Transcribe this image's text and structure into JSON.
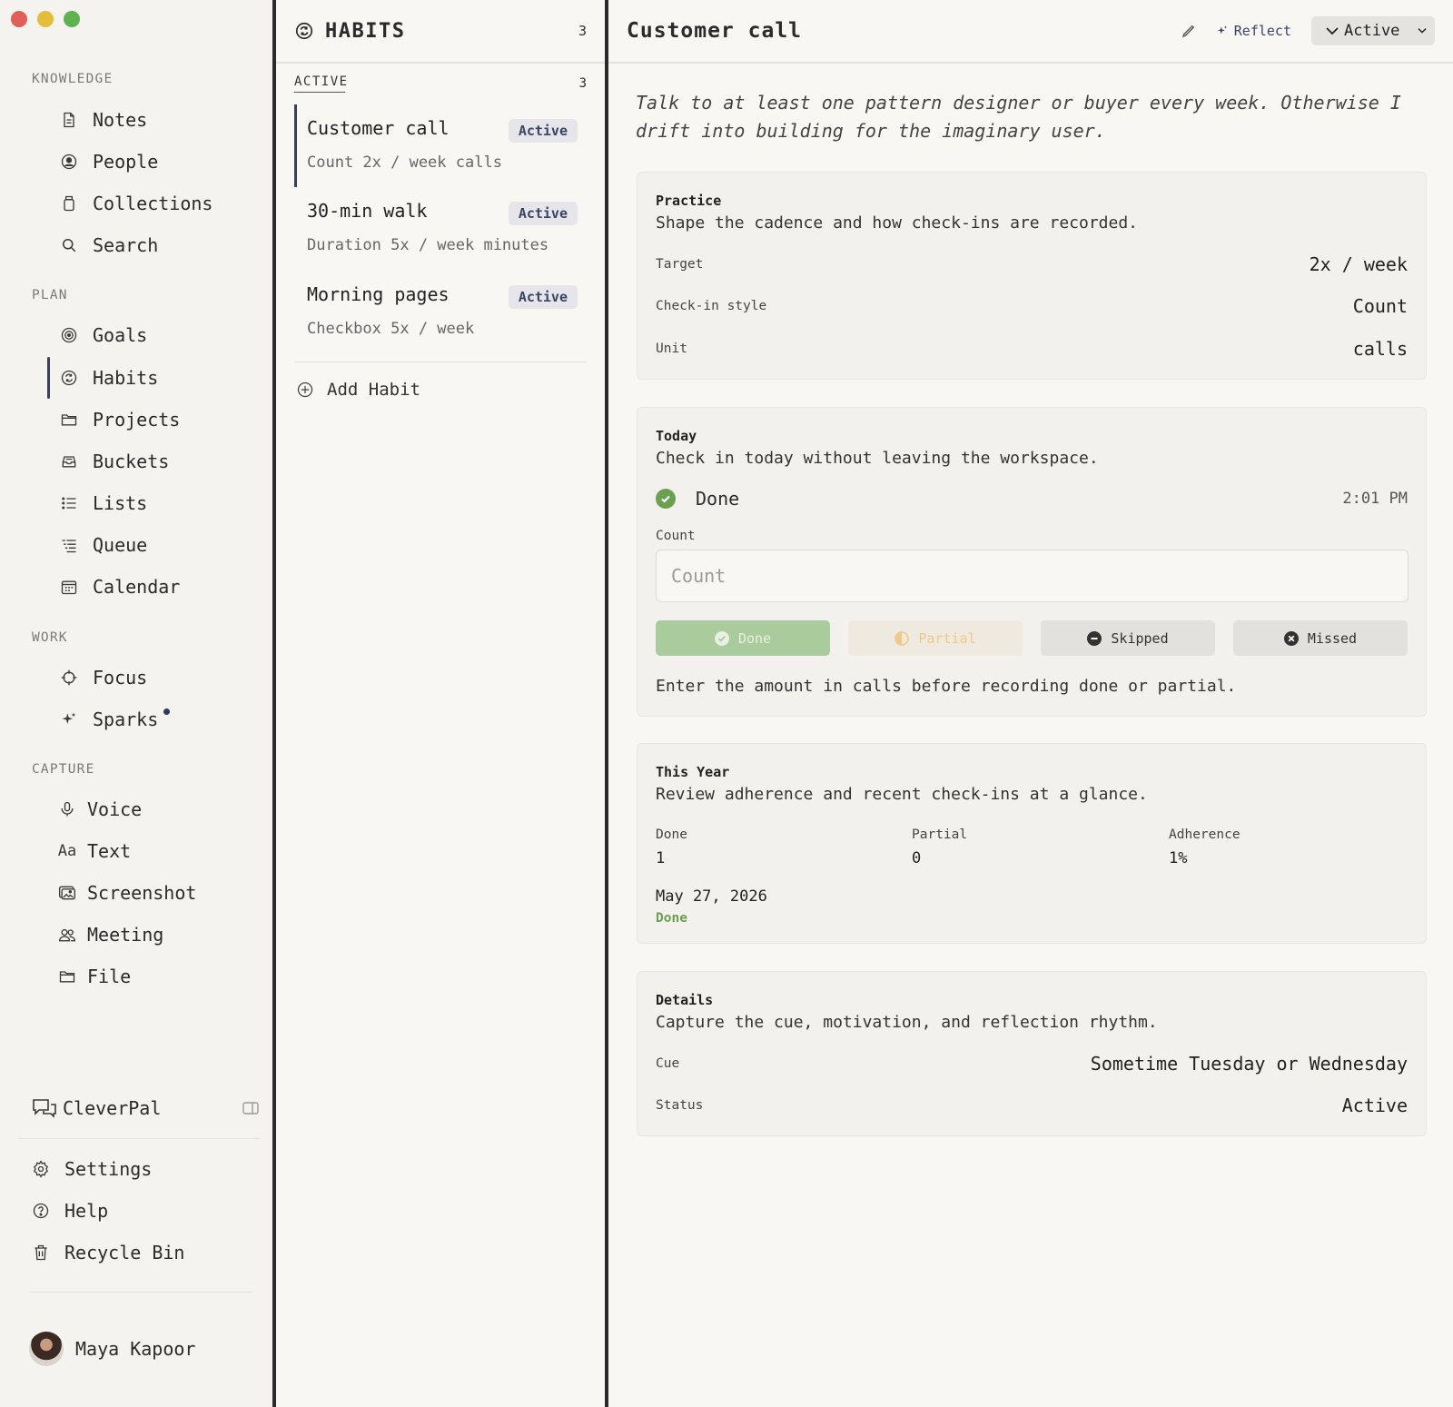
{
  "sidebar": {
    "sections": {
      "knowledge": "KNOWLEDGE",
      "plan": "PLAN",
      "work": "WORK",
      "capture": "CAPTURE"
    },
    "knowledge_items": [
      {
        "label": "Notes",
        "icon": "document-icon"
      },
      {
        "label": "People",
        "icon": "person-circle-icon"
      },
      {
        "label": "Collections",
        "icon": "jar-icon"
      },
      {
        "label": "Search",
        "icon": "search-icon"
      }
    ],
    "plan_items": [
      {
        "label": "Goals",
        "icon": "target-icon"
      },
      {
        "label": "Habits",
        "icon": "repeat-icon",
        "active": true
      },
      {
        "label": "Projects",
        "icon": "folder-icon"
      },
      {
        "label": "Buckets",
        "icon": "inbox-tray-icon"
      },
      {
        "label": "Lists",
        "icon": "list-icon"
      },
      {
        "label": "Queue",
        "icon": "queue-icon"
      },
      {
        "label": "Calendar",
        "icon": "calendar-icon"
      }
    ],
    "work_items": [
      {
        "label": "Focus",
        "icon": "crosshair-icon"
      },
      {
        "label": "Sparks",
        "icon": "sparkle-icon",
        "has_dot": true
      }
    ],
    "capture_items": [
      {
        "label": "Voice",
        "icon": "microphone-icon"
      },
      {
        "label": "Text",
        "icon": "text-aa-icon",
        "glyph": "Aa"
      },
      {
        "label": "Screenshot",
        "icon": "screenshot-icon"
      },
      {
        "label": "Meeting",
        "icon": "people-icon"
      },
      {
        "label": "File",
        "icon": "folder-icon"
      }
    ],
    "assistant": {
      "label": "CleverPal",
      "icon": "chat-bubbles-icon",
      "toggle_icon": "panel-toggle-icon"
    },
    "footer_items": [
      {
        "label": "Settings",
        "icon": "gear-icon"
      },
      {
        "label": "Help",
        "icon": "question-icon"
      },
      {
        "label": "Recycle Bin",
        "icon": "trash-icon"
      }
    ],
    "user": {
      "name": "Maya Kapoor"
    }
  },
  "habits_pane": {
    "title": "HABITS",
    "count": "3",
    "group_label": "ACTIVE",
    "group_count": "3",
    "items": [
      {
        "name": "Customer call",
        "meta": "Count 2x / week calls",
        "badge": "Active",
        "selected": true
      },
      {
        "name": "30-min walk",
        "meta": "Duration 5x / week minutes",
        "badge": "Active"
      },
      {
        "name": "Morning pages",
        "meta": "Checkbox 5x / week",
        "badge": "Active"
      }
    ],
    "add_label": "Add Habit"
  },
  "detail": {
    "title": "Customer call",
    "reflect_label": "Reflect",
    "status_value": "Active",
    "description": "Talk to at least one pattern designer or buyer every week. Otherwise I drift into building for the imaginary user.",
    "practice": {
      "title": "Practice",
      "subtitle": "Shape the cadence and how check-ins are recorded.",
      "rows": [
        {
          "label": "Target",
          "value": "2x / week"
        },
        {
          "label": "Check-in style",
          "value": "Count"
        },
        {
          "label": "Unit",
          "value": "calls"
        }
      ]
    },
    "today": {
      "title": "Today",
      "subtitle": "Check in today without leaving the workspace.",
      "status_label": "Done",
      "time": "2:01 PM",
      "count_label": "Count",
      "count_value": "",
      "count_placeholder": "Count",
      "buttons": {
        "done": "Done",
        "partial": "Partial",
        "skipped": "Skipped",
        "missed": "Missed"
      },
      "hint": "Enter the amount in calls before recording done or partial."
    },
    "year": {
      "title": "This Year",
      "subtitle": "Review adherence and recent check-ins at a glance.",
      "stats": [
        {
          "label": "Done",
          "value": "1"
        },
        {
          "label": "Partial",
          "value": "0"
        },
        {
          "label": "Adherence",
          "value": "1%"
        }
      ],
      "recent_date": "May 27, 2026",
      "recent_status": "Done"
    },
    "details": {
      "title": "Details",
      "subtitle": "Capture the cue, motivation, and reflection rhythm.",
      "rows": [
        {
          "label": "Cue",
          "value": "Sometime Tuesday or Wednesday"
        },
        {
          "label": "Status",
          "value": "Active"
        }
      ]
    }
  },
  "colors": {
    "accent": "#3c3f5a",
    "done_green": "#6aa04f",
    "partial_amber": "#eec98a",
    "badge_text": "#3a4464"
  }
}
